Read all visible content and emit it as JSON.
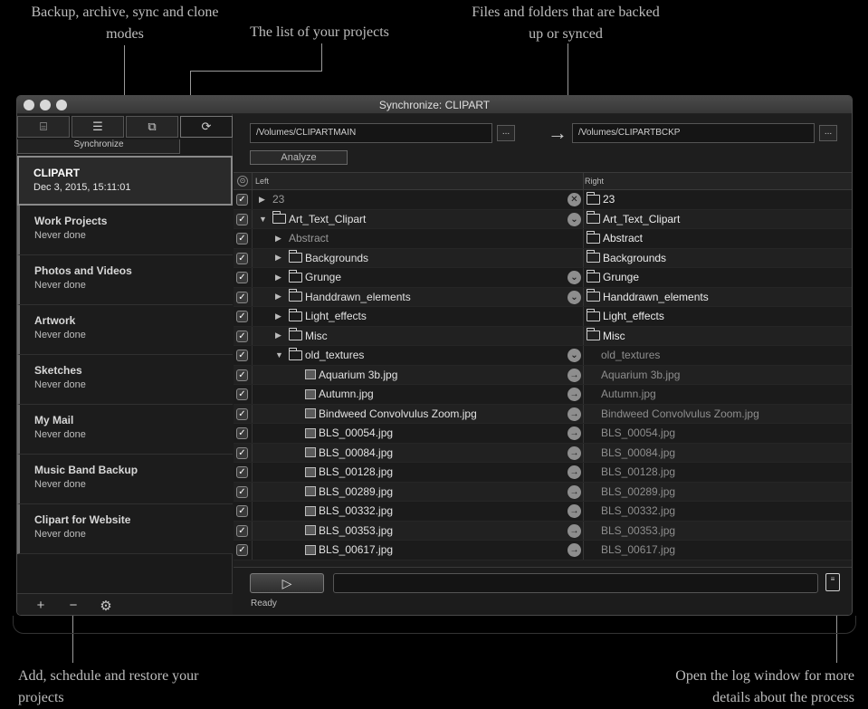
{
  "annotations": {
    "modes": "Backup, archive, sync and clone modes",
    "projects_list": "The list of your projects",
    "files": "Files and folders that are backed up or synced",
    "add": "Add, schedule and restore your projects",
    "log": "Open the log window for more details about the process"
  },
  "window": {
    "title": "Synchronize: CLIPART"
  },
  "sidebar": {
    "modes": [
      {
        "name": "backup",
        "icon": "backup-icon"
      },
      {
        "name": "archive",
        "icon": "archive-icon"
      },
      {
        "name": "sync",
        "icon": "sync-icon"
      },
      {
        "name": "clone",
        "icon": "clone-icon"
      }
    ],
    "active_mode_label": "Synchronize",
    "projects": [
      {
        "name": "CLIPART",
        "date": "Dec 3, 2015, 15:11:01",
        "selected": true
      },
      {
        "name": "Work Projects",
        "date": "Never done"
      },
      {
        "name": "Photos and Videos",
        "date": "Never done"
      },
      {
        "name": "Artwork",
        "date": "Never done"
      },
      {
        "name": "Sketches",
        "date": "Never done"
      },
      {
        "name": "My Mail",
        "date": "Never done"
      },
      {
        "name": "Music Band Backup",
        "date": "Never done"
      },
      {
        "name": "Clipart for Website",
        "date": "Never done"
      }
    ],
    "footer": {
      "add": "+",
      "remove": "−",
      "settings": "⚙"
    }
  },
  "main": {
    "left_path": "/Volumes/CLIPARTMAIN",
    "right_path": "/Volumes/CLIPARTBCKP",
    "browse_label": "...",
    "direction_arrow": "→",
    "analyze_label": "Analyze",
    "columns": {
      "check": "⊙",
      "left": "Left",
      "right": "Right"
    },
    "rows": [
      {
        "indent": 0,
        "tri": "▶",
        "kind": "none",
        "left": "23",
        "left_dim": true,
        "action": "✕",
        "right_kind": "folder",
        "right": "23",
        "right_style": "bold"
      },
      {
        "indent": 0,
        "tri": "▼",
        "kind": "folder",
        "left": "Art_Text_Clipart",
        "action": "⌄",
        "right_kind": "folder",
        "right": "Art_Text_Clipart",
        "right_style": "bold"
      },
      {
        "indent": 1,
        "tri": "▶",
        "kind": "none",
        "left": "Abstract",
        "left_dim": true,
        "action": "",
        "right_kind": "folder",
        "right": "Abstract",
        "right_style": "bold"
      },
      {
        "indent": 1,
        "tri": "▶",
        "kind": "folder",
        "left": "Backgrounds",
        "action": "",
        "right_kind": "folder",
        "right": "Backgrounds",
        "right_style": "bold"
      },
      {
        "indent": 1,
        "tri": "▶",
        "kind": "folder",
        "left": "Grunge",
        "action": "⌄",
        "right_kind": "folder",
        "right": "Grunge",
        "right_style": "bold"
      },
      {
        "indent": 1,
        "tri": "▶",
        "kind": "folder",
        "left": "Handdrawn_elements",
        "action": "⌄",
        "right_kind": "folder",
        "right": "Handdrawn_elements",
        "right_style": "bold"
      },
      {
        "indent": 1,
        "tri": "▶",
        "kind": "folder",
        "left": "Light_effects",
        "action": "",
        "right_kind": "folder",
        "right": "Light_effects",
        "right_style": "bold"
      },
      {
        "indent": 1,
        "tri": "▶",
        "kind": "folder",
        "left": "Misc",
        "action": "",
        "right_kind": "folder",
        "right": "Misc",
        "right_style": "bold"
      },
      {
        "indent": 1,
        "tri": "▼",
        "kind": "folder",
        "left": "old_textures",
        "action": "⌄",
        "right_kind": "none",
        "right": "old_textures",
        "right_style": "pending"
      },
      {
        "indent": 2,
        "tri": "",
        "kind": "file",
        "left": "Aquarium 3b.jpg",
        "action": "→",
        "right_kind": "none",
        "right": "Aquarium 3b.jpg",
        "right_style": "pending"
      },
      {
        "indent": 2,
        "tri": "",
        "kind": "file",
        "left": "Autumn.jpg",
        "action": "→",
        "right_kind": "none",
        "right": "Autumn.jpg",
        "right_style": "pending"
      },
      {
        "indent": 2,
        "tri": "",
        "kind": "file",
        "left": "Bindweed Convolvulus Zoom.jpg",
        "action": "→",
        "right_kind": "none",
        "right": "Bindweed Convolvulus Zoom.jpg",
        "right_style": "pending"
      },
      {
        "indent": 2,
        "tri": "",
        "kind": "file",
        "left": "BLS_00054.jpg",
        "action": "→",
        "right_kind": "none",
        "right": "BLS_00054.jpg",
        "right_style": "pending"
      },
      {
        "indent": 2,
        "tri": "",
        "kind": "file",
        "left": "BLS_00084.jpg",
        "action": "→",
        "right_kind": "none",
        "right": "BLS_00084.jpg",
        "right_style": "pending"
      },
      {
        "indent": 2,
        "tri": "",
        "kind": "file",
        "left": "BLS_00128.jpg",
        "action": "→",
        "right_kind": "none",
        "right": "BLS_00128.jpg",
        "right_style": "pending"
      },
      {
        "indent": 2,
        "tri": "",
        "kind": "file",
        "left": "BLS_00289.jpg",
        "action": "→",
        "right_kind": "none",
        "right": "BLS_00289.jpg",
        "right_style": "pending"
      },
      {
        "indent": 2,
        "tri": "",
        "kind": "file",
        "left": "BLS_00332.jpg",
        "action": "→",
        "right_kind": "none",
        "right": "BLS_00332.jpg",
        "right_style": "pending"
      },
      {
        "indent": 2,
        "tri": "",
        "kind": "file",
        "left": "BLS_00353.jpg",
        "action": "→",
        "right_kind": "none",
        "right": "BLS_00353.jpg",
        "right_style": "pending"
      },
      {
        "indent": 2,
        "tri": "",
        "kind": "file",
        "left": "BLS_00617.jpg",
        "action": "→",
        "right_kind": "none",
        "right": "BLS_00617.jpg",
        "right_style": "pending"
      }
    ],
    "run_label": "▷",
    "status": "Ready",
    "log_icon": "≡"
  }
}
